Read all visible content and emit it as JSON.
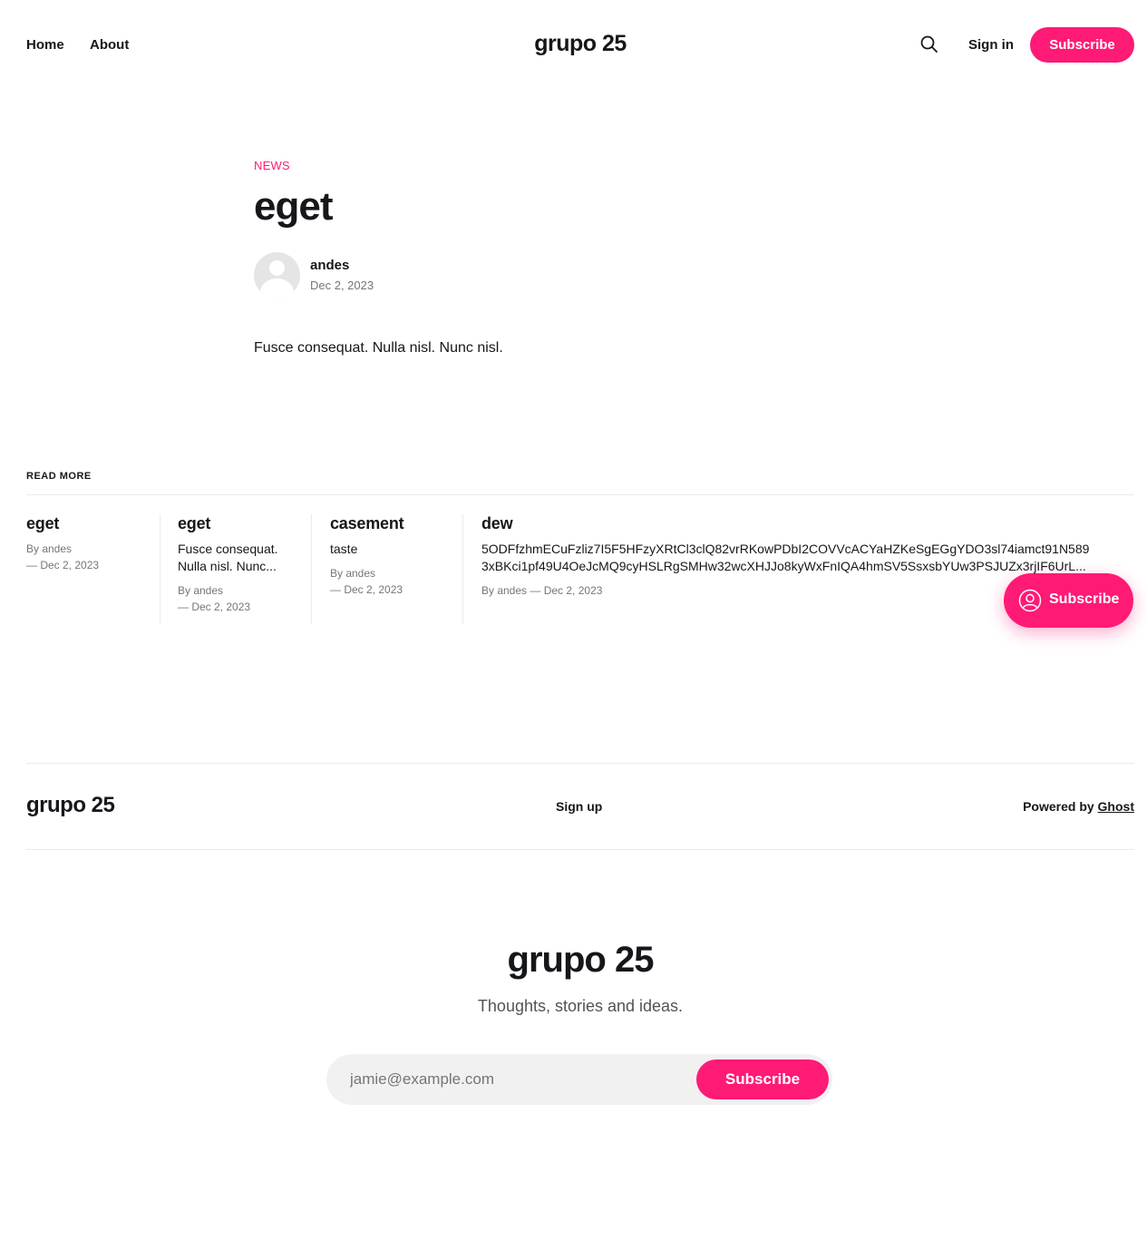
{
  "nav": {
    "home": "Home",
    "about": "About",
    "site_title": "grupo 25",
    "signin": "Sign in",
    "subscribe": "Subscribe",
    "search_icon": "search-icon"
  },
  "article": {
    "tag": "NEWS",
    "title": "eget",
    "author": "andes",
    "date": "Dec 2, 2023",
    "body": "Fusce consequat. Nulla nisl. Nunc nisl."
  },
  "read_more": {
    "heading": "READ MORE",
    "cards": [
      {
        "title": "eget",
        "excerpt": "",
        "author_line": "By andes",
        "date_line": "— Dec 2, 2023"
      },
      {
        "title": "eget",
        "excerpt": "Fusce consequat. Nulla nisl. Nunc...",
        "author_line": "By andes",
        "date_line": "— Dec 2, 2023"
      },
      {
        "title": "casement",
        "excerpt": "taste",
        "author_line": "By andes",
        "date_line": "— Dec 2, 2023"
      },
      {
        "title": "dew",
        "excerpt_line1": "5ODFfzhmECuFzliz7I5F5HFzyXRtCl3clQ82vrRKowPDbI2COVVcACYaHZKeSgEGgYDO3sl74iamct91N589",
        "excerpt_line2": "3xBKci1pf49U4OeJcMQ9cyHSLRgSMHw32wcXHJJo8kyWxFnIQA4hmSV5SsxsbYUw3PSJUZx3rjIF6UrL...",
        "meta": "By andes — Dec 2, 2023"
      }
    ]
  },
  "floating": {
    "label": "Subscribe"
  },
  "footer": {
    "title": "grupo 25",
    "signup": "Sign up",
    "powered_prefix": "Powered by ",
    "powered_link": "Ghost"
  },
  "cta": {
    "title": "grupo 25",
    "description": "Thoughts, stories and ideas.",
    "placeholder": "jamie@example.com",
    "button": "Subscribe"
  },
  "colors": {
    "accent": "#ff1a75",
    "text": "#15171a",
    "muted": "#73767a",
    "divider": "#ebebeb"
  }
}
